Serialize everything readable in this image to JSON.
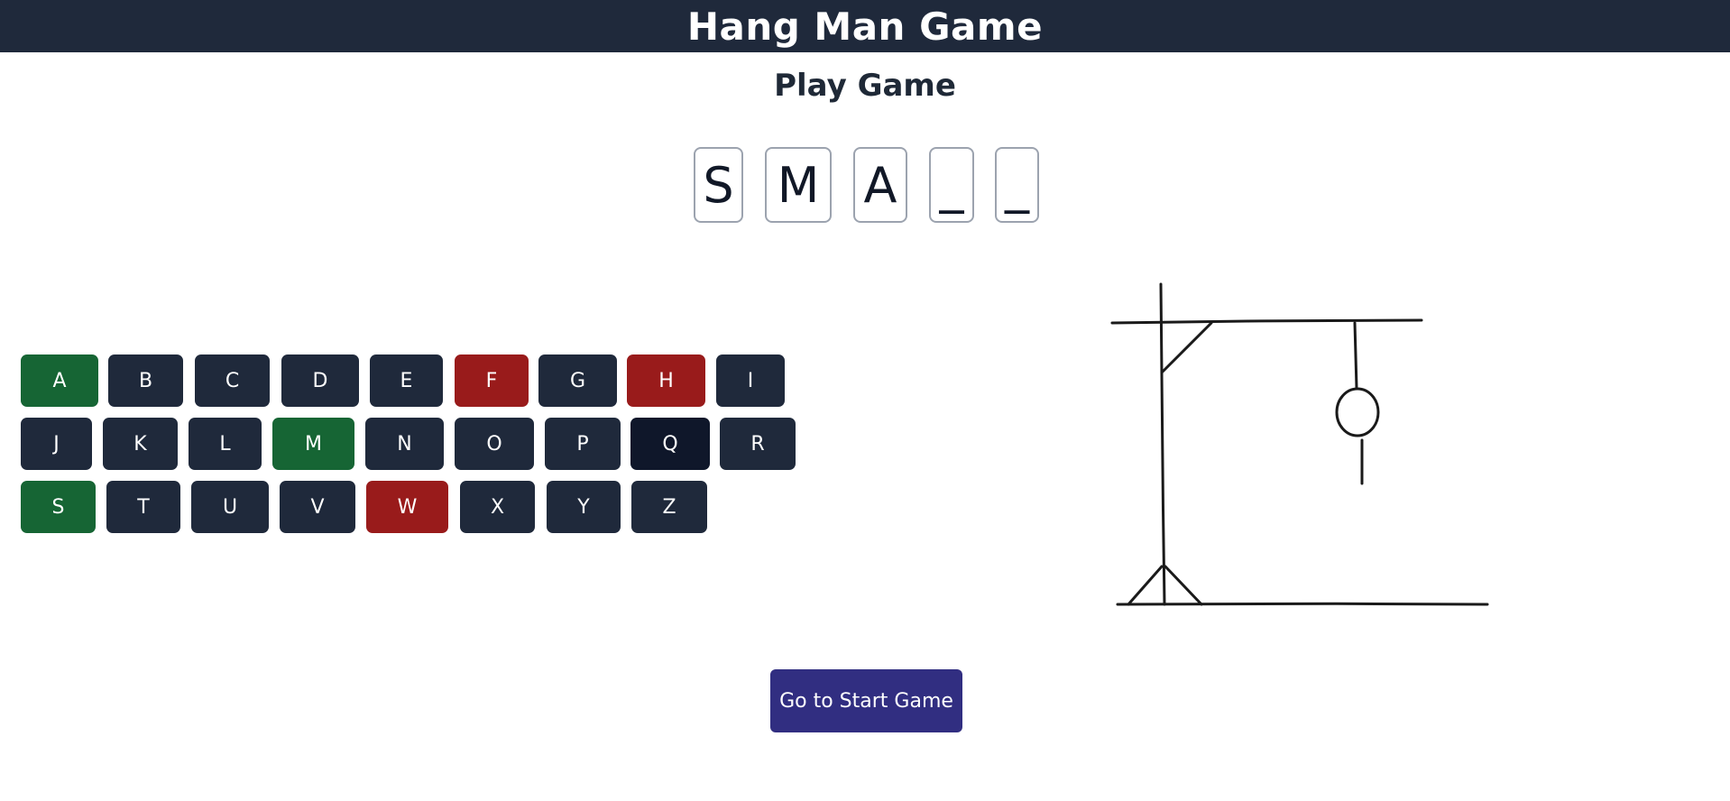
{
  "header": {
    "title": "Hang Man Game"
  },
  "main": {
    "subtitle": "Play Game",
    "word": [
      "S",
      "M",
      "A",
      "_",
      "_"
    ],
    "keyboard": {
      "rows": [
        [
          {
            "letter": "A",
            "state": "correct"
          },
          {
            "letter": "B",
            "state": "default"
          },
          {
            "letter": "C",
            "state": "default"
          },
          {
            "letter": "D",
            "state": "default"
          },
          {
            "letter": "E",
            "state": "default"
          },
          {
            "letter": "F",
            "state": "wrong"
          },
          {
            "letter": "G",
            "state": "default"
          },
          {
            "letter": "H",
            "state": "wrong"
          },
          {
            "letter": "I",
            "state": "default"
          }
        ],
        [
          {
            "letter": "J",
            "state": "default"
          },
          {
            "letter": "K",
            "state": "default"
          },
          {
            "letter": "L",
            "state": "default"
          },
          {
            "letter": "M",
            "state": "correct"
          },
          {
            "letter": "N",
            "state": "default"
          },
          {
            "letter": "O",
            "state": "default"
          },
          {
            "letter": "P",
            "state": "default"
          },
          {
            "letter": "Q",
            "state": "hover"
          },
          {
            "letter": "R",
            "state": "default"
          }
        ],
        [
          {
            "letter": "S",
            "state": "correct"
          },
          {
            "letter": "T",
            "state": "default"
          },
          {
            "letter": "U",
            "state": "default"
          },
          {
            "letter": "V",
            "state": "default"
          },
          {
            "letter": "W",
            "state": "wrong"
          },
          {
            "letter": "X",
            "state": "default"
          },
          {
            "letter": "Y",
            "state": "default"
          },
          {
            "letter": "Z",
            "state": "default"
          }
        ]
      ]
    },
    "hangman": {
      "wrong_guesses": 3
    },
    "start_button_label": "Go to Start Game"
  },
  "colors": {
    "header_bg": "#1f293b",
    "key_default": "#1f293b",
    "key_correct": "#166534",
    "key_wrong": "#991b1b",
    "key_hover": "#0f172a",
    "start_button": "#312e81"
  }
}
